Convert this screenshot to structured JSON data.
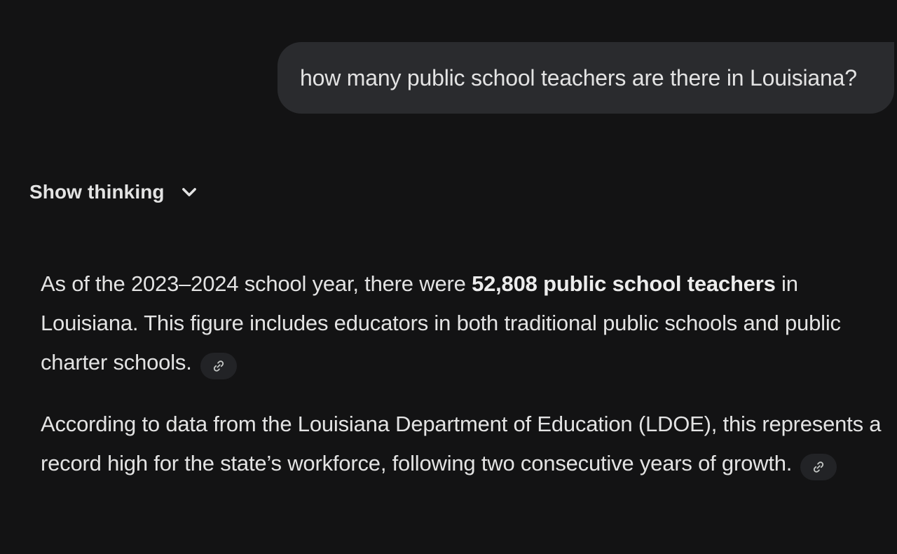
{
  "user_message": {
    "text": "how many public school teachers are there in Louisiana?"
  },
  "thinking": {
    "label": "Show thinking",
    "icon": "chevron-down-icon"
  },
  "response": {
    "paragraph1": {
      "before": "As of the 2023–2024 school year, there were ",
      "bold": "52,808 public school teachers",
      "after": " in Louisiana. This figure includes educators in both traditional public schools and public charter schools."
    },
    "paragraph2": {
      "text": "According to data from the Louisiana Department of Education (LDOE), this represents a record high for the state’s workforce, following two consecutive years of growth."
    },
    "citation_icon": "link-icon"
  },
  "colors": {
    "background": "#131314",
    "user_bubble": "#2a2b2e",
    "text": "#e3e3e3",
    "citation_chip": "#222326"
  }
}
